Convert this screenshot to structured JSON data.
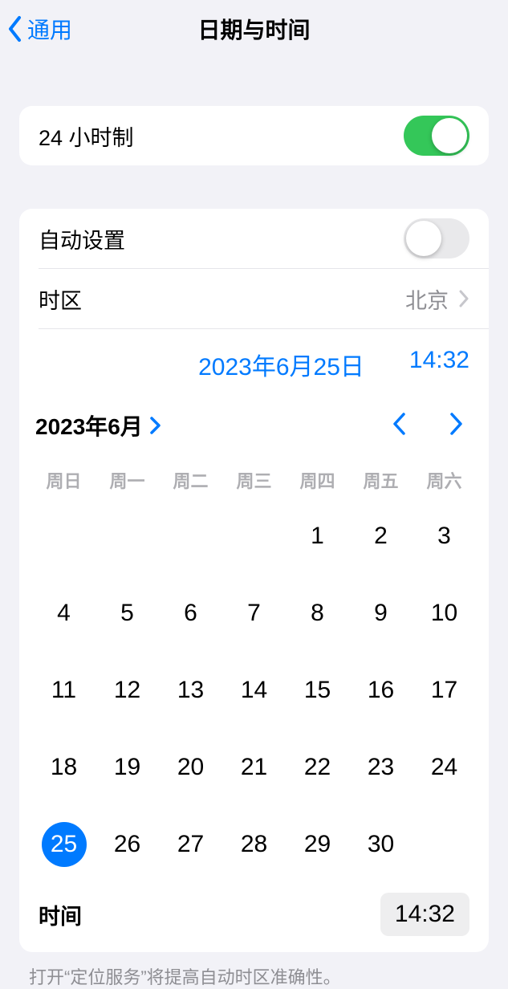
{
  "nav": {
    "back": "通用",
    "title": "日期与时间"
  },
  "twentyFourHour": {
    "label": "24 小时制",
    "on": true
  },
  "autoSet": {
    "label": "自动设置",
    "on": false
  },
  "timezone": {
    "label": "时区",
    "value": "北京"
  },
  "selected": {
    "date": "2023年6月25日",
    "time": "14:32"
  },
  "calendar": {
    "title": "2023年6月",
    "weekdays": [
      "周日",
      "周一",
      "周二",
      "周三",
      "周四",
      "周五",
      "周六"
    ],
    "leadingBlanks": 4,
    "days": [
      1,
      2,
      3,
      4,
      5,
      6,
      7,
      8,
      9,
      10,
      11,
      12,
      13,
      14,
      15,
      16,
      17,
      18,
      19,
      20,
      21,
      22,
      23,
      24,
      25,
      26,
      27,
      28,
      29,
      30
    ],
    "selectedDay": 25
  },
  "timeRow": {
    "label": "时间",
    "value": "14:32"
  },
  "footer": "打开“定位服务”将提高自动时区准确性。"
}
